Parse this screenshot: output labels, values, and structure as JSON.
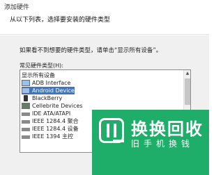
{
  "window": {
    "title": "添加硬件"
  },
  "header": {
    "subtitle": "从以下列表，选择要安装的硬件类型"
  },
  "content": {
    "instruction": "如果看不到想要的硬件类型，请单击“显示所有设备”。",
    "list_label": "常见硬件类型(H):",
    "items": [
      {
        "label": "显示所有设备",
        "icon": "none",
        "selected": false
      },
      {
        "label": "ADB Interface",
        "icon": "monitor-icon",
        "selected": false
      },
      {
        "label": "Android Device",
        "icon": "monitor-icon",
        "selected": true
      },
      {
        "label": "BlackBerry",
        "icon": "phone-icon",
        "selected": false
      },
      {
        "label": "Cellebrite Devices",
        "icon": "chip-icon",
        "selected": false
      },
      {
        "label": "IDE ATA/ATAPI",
        "icon": "port-icon",
        "selected": false
      },
      {
        "label": "IEEE 1284.4 聚合",
        "icon": "port-icon",
        "selected": false
      },
      {
        "label": "IEEE 1284.4 设备",
        "icon": "port-icon",
        "selected": false
      },
      {
        "label": "IEEE 1394 主控",
        "icon": "port-icon",
        "selected": false
      }
    ]
  },
  "watermark": {
    "title": "换换回收",
    "subtitle": "旧手机换钱"
  }
}
